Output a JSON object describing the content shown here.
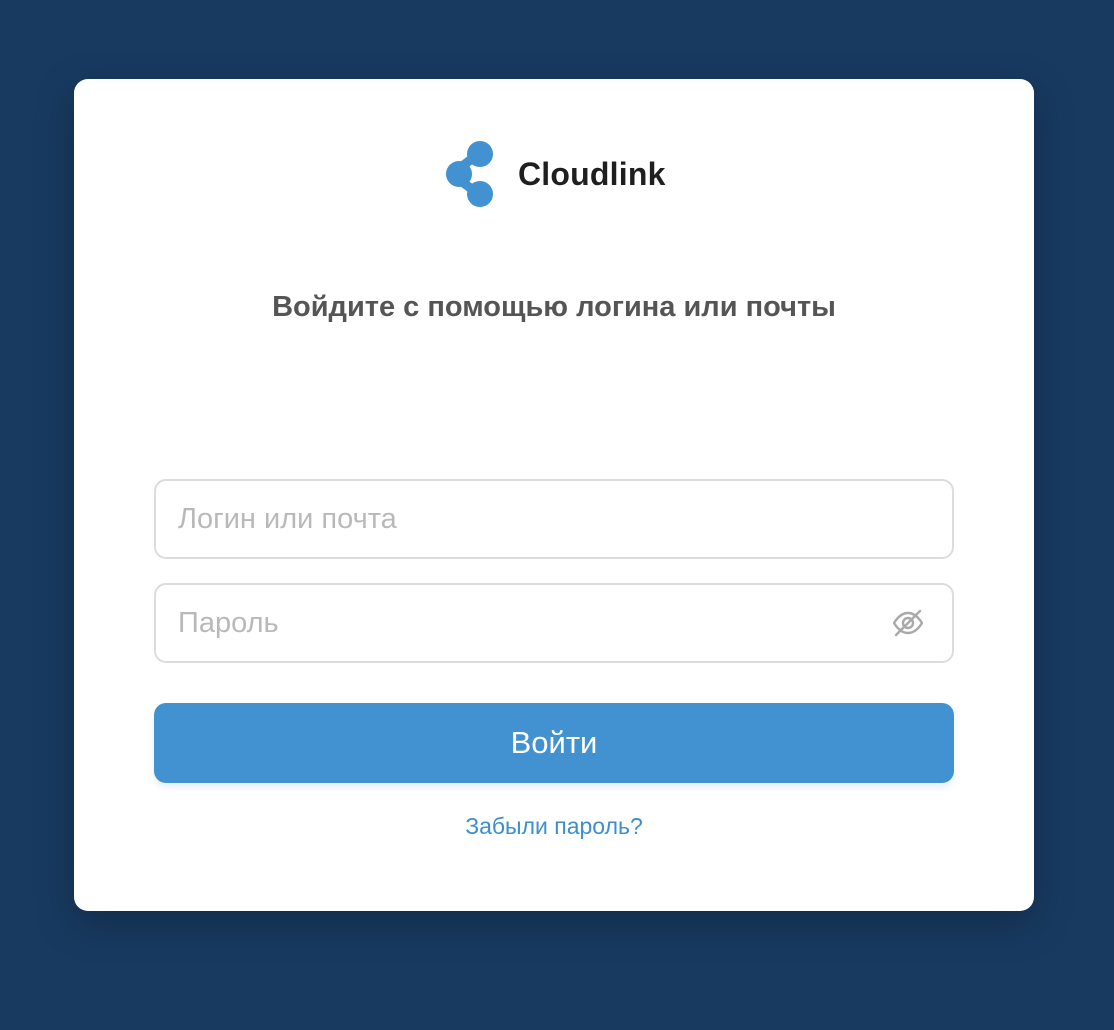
{
  "colors": {
    "background": "#183a61",
    "card": "#ffffff",
    "brand_accent": "#4292d1",
    "link": "#3d8fcc",
    "heading": "#555555"
  },
  "brand": {
    "name": "Cloudlink",
    "icon": "cloudlink-logo-icon"
  },
  "form": {
    "heading": "Войдите с помощью логина или почты",
    "login": {
      "placeholder": "Логин или почта",
      "value": ""
    },
    "password": {
      "placeholder": "Пароль",
      "value": "",
      "toggle_icon": "eye-off-icon"
    },
    "submit_label": "Войти",
    "forgot_label": "Забыли пароль?"
  }
}
